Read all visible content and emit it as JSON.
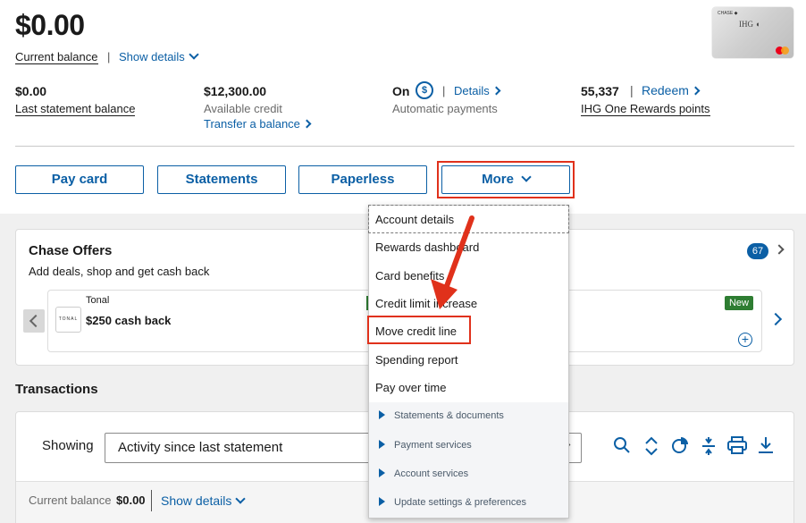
{
  "header": {
    "balance": "$0.00",
    "balance_label": "Current balance",
    "separator": "|",
    "show_details": "Show details"
  },
  "stats": {
    "last_statement": {
      "value": "$0.00",
      "label": "Last statement balance"
    },
    "available_credit": {
      "value": "$12,300.00",
      "label": "Available credit",
      "link": "Transfer a balance"
    },
    "autopay": {
      "value": "On",
      "link": "Details",
      "label": "Automatic payments"
    },
    "rewards": {
      "value": "55,337",
      "link": "Redeem",
      "label": "IHG One Rewards points"
    }
  },
  "actions": {
    "pay": "Pay card",
    "statements": "Statements",
    "paperless": "Paperless",
    "more": "More"
  },
  "more_menu": {
    "items": [
      "Account details",
      "Rewards dashboard",
      "Card benefits",
      "Credit limit increase",
      "Move credit line",
      "Spending report",
      "Pay over time"
    ],
    "sections": [
      "Statements & documents",
      "Payment services",
      "Account services",
      "Update settings & preferences"
    ]
  },
  "offers": {
    "title": "Chase Offers",
    "subtitle": "Add deals, shop and get cash back",
    "count": "67",
    "card": {
      "merchant": "Tonal",
      "logo_text": "TONAL",
      "amount": "$250 cash back",
      "badge": "New",
      "add": "+"
    }
  },
  "transactions": {
    "title": "Transactions",
    "showing_label": "Showing",
    "filter_value": "Activity since last statement",
    "footer": {
      "balance_label": "Current balance",
      "balance_value": "$0.00",
      "show_details": "Show details"
    }
  },
  "colors": {
    "brand": "#0b5fa5",
    "highlight": "#e0311b",
    "badge_green": "#2e7d32"
  }
}
